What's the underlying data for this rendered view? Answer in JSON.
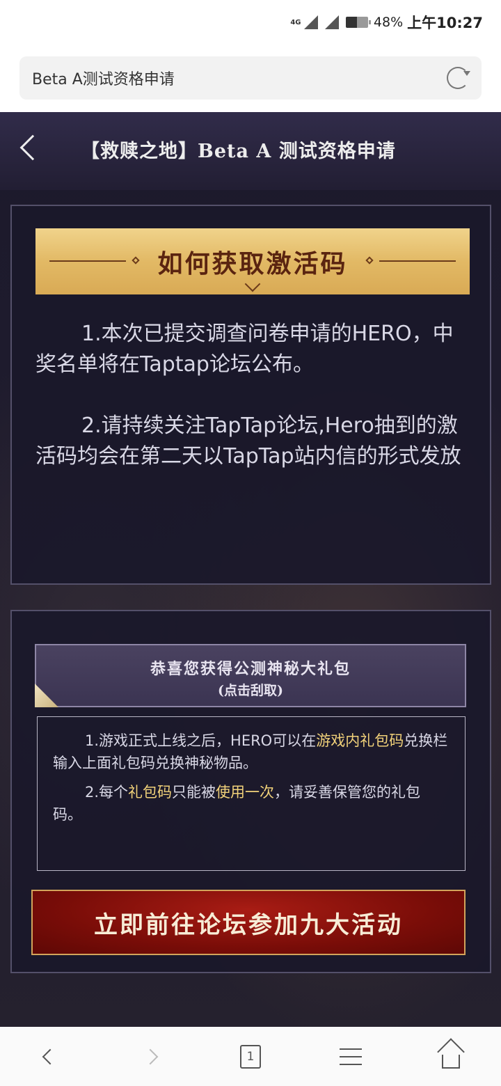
{
  "status_bar": {
    "network": "4G",
    "battery_percent": "48%",
    "time": "上午10:27"
  },
  "browser": {
    "address_text": "Beta A测试资格申请"
  },
  "header": {
    "title": "【救赎之地】Beta A 测试资格申请"
  },
  "section1": {
    "banner_title": "如何获取激活码",
    "notice1": "1.本次已提交调查问卷申请的HERO，中奖名单将在Taptap论坛公布。",
    "notice2": "2.请持续关注TapTap论坛,Hero抽到的激活码均会在第二天以TapTap站内信的形式发放"
  },
  "section2": {
    "gift_line1": "恭喜您获得公测神秘大礼包",
    "gift_line2": "(点击刮取)",
    "rule1": {
      "p1": "1.游戏正式上线之后，HERO可以在",
      "hl1": "游戏内礼包码",
      "p2": "兑换栏输入上面礼包码兑换神秘物品。"
    },
    "rule2": {
      "p1": "2.每个",
      "hl1": "礼包码",
      "p2": "只能被",
      "hl2": "使用一次",
      "p3": "，请妥善保管您的礼包码。"
    },
    "cta_label": "立即前往论坛参加九大活动"
  },
  "bottom_nav": {
    "tab_count": "1"
  },
  "colors": {
    "accent_gold": "#e2b965",
    "highlight": "#f2d27a",
    "cta_red": "#7a0d08"
  }
}
